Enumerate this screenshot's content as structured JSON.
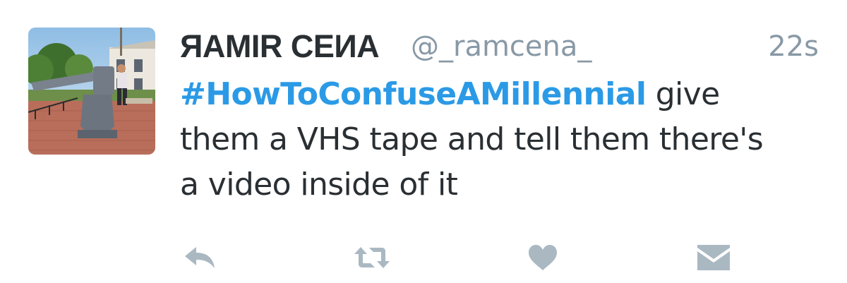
{
  "tweet": {
    "author": {
      "display_name": "ЯAMIR CEИA",
      "handle": "@_ramcena_"
    },
    "timestamp": "22s",
    "text": {
      "hashtag": "#HowToConfuseAMillennial",
      "line1_rest": " give",
      "line2": "them a VHS tape and tell them there's",
      "line3": "a video inside of it"
    },
    "actions": [
      {
        "icon": "reply-icon"
      },
      {
        "icon": "retweet-icon"
      },
      {
        "icon": "heart-icon"
      },
      {
        "icon": "direct-message-icon"
      }
    ]
  },
  "colors": {
    "text": "#292f33",
    "secondary": "#8899a6",
    "hashtag": "#2b9ae6",
    "action_icon": "#aab8c2"
  }
}
